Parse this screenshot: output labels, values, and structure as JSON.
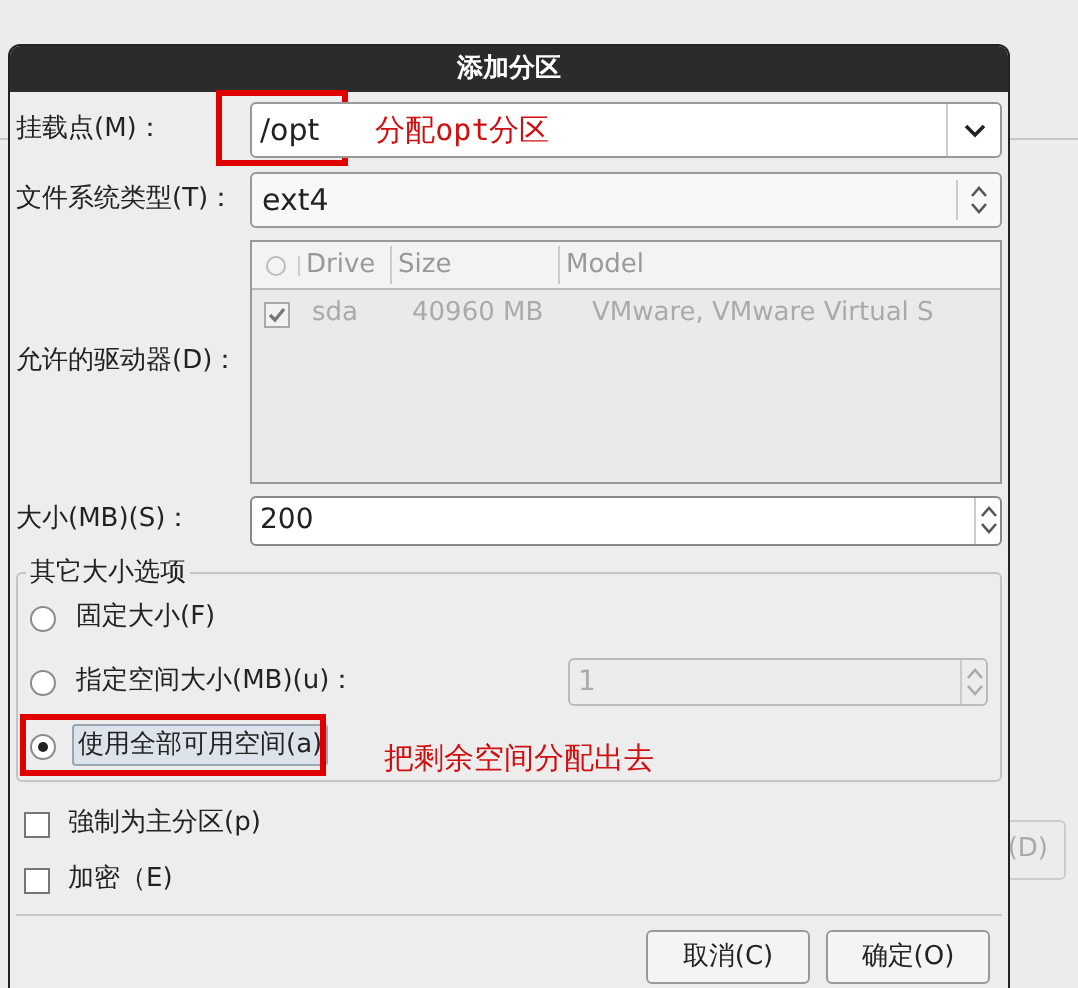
{
  "background": {
    "side_button": "(D)"
  },
  "dialog": {
    "title": "添加分区",
    "mount_point": {
      "label": "挂载点(M)：",
      "value": "/opt",
      "annotation": "分配opt分区"
    },
    "fs_type": {
      "label": "文件系统类型(T)：",
      "value": "ext4"
    },
    "drives": {
      "label": "允许的驱动器(D)：",
      "columns": [
        "Drive",
        "Size",
        "Model"
      ],
      "rows": [
        {
          "checked": true,
          "drive": "sda",
          "size": "40960 MB",
          "model": "VMware, VMware Virtual S"
        }
      ]
    },
    "size": {
      "label": "大小(MB)(S)：",
      "value": "200"
    },
    "size_options": {
      "title": "其它大小选项",
      "options": [
        {
          "kind": "plain",
          "label": "固定大小(F)",
          "selected": false
        },
        {
          "kind": "spin",
          "label": "指定空间大小(MB)(u)：",
          "value": "1",
          "disabled": true,
          "selected": false
        },
        {
          "kind": "plain",
          "label": "使用全部可用空间(a)",
          "selected": true,
          "annotation": "把剩余空间分配出去"
        }
      ]
    },
    "checkboxes": [
      {
        "label": "強制为主分区(p)",
        "checked": false
      },
      {
        "label": "加密（E)",
        "checked": false
      }
    ],
    "buttons": [
      "取消(C)",
      "确定(O)"
    ]
  }
}
